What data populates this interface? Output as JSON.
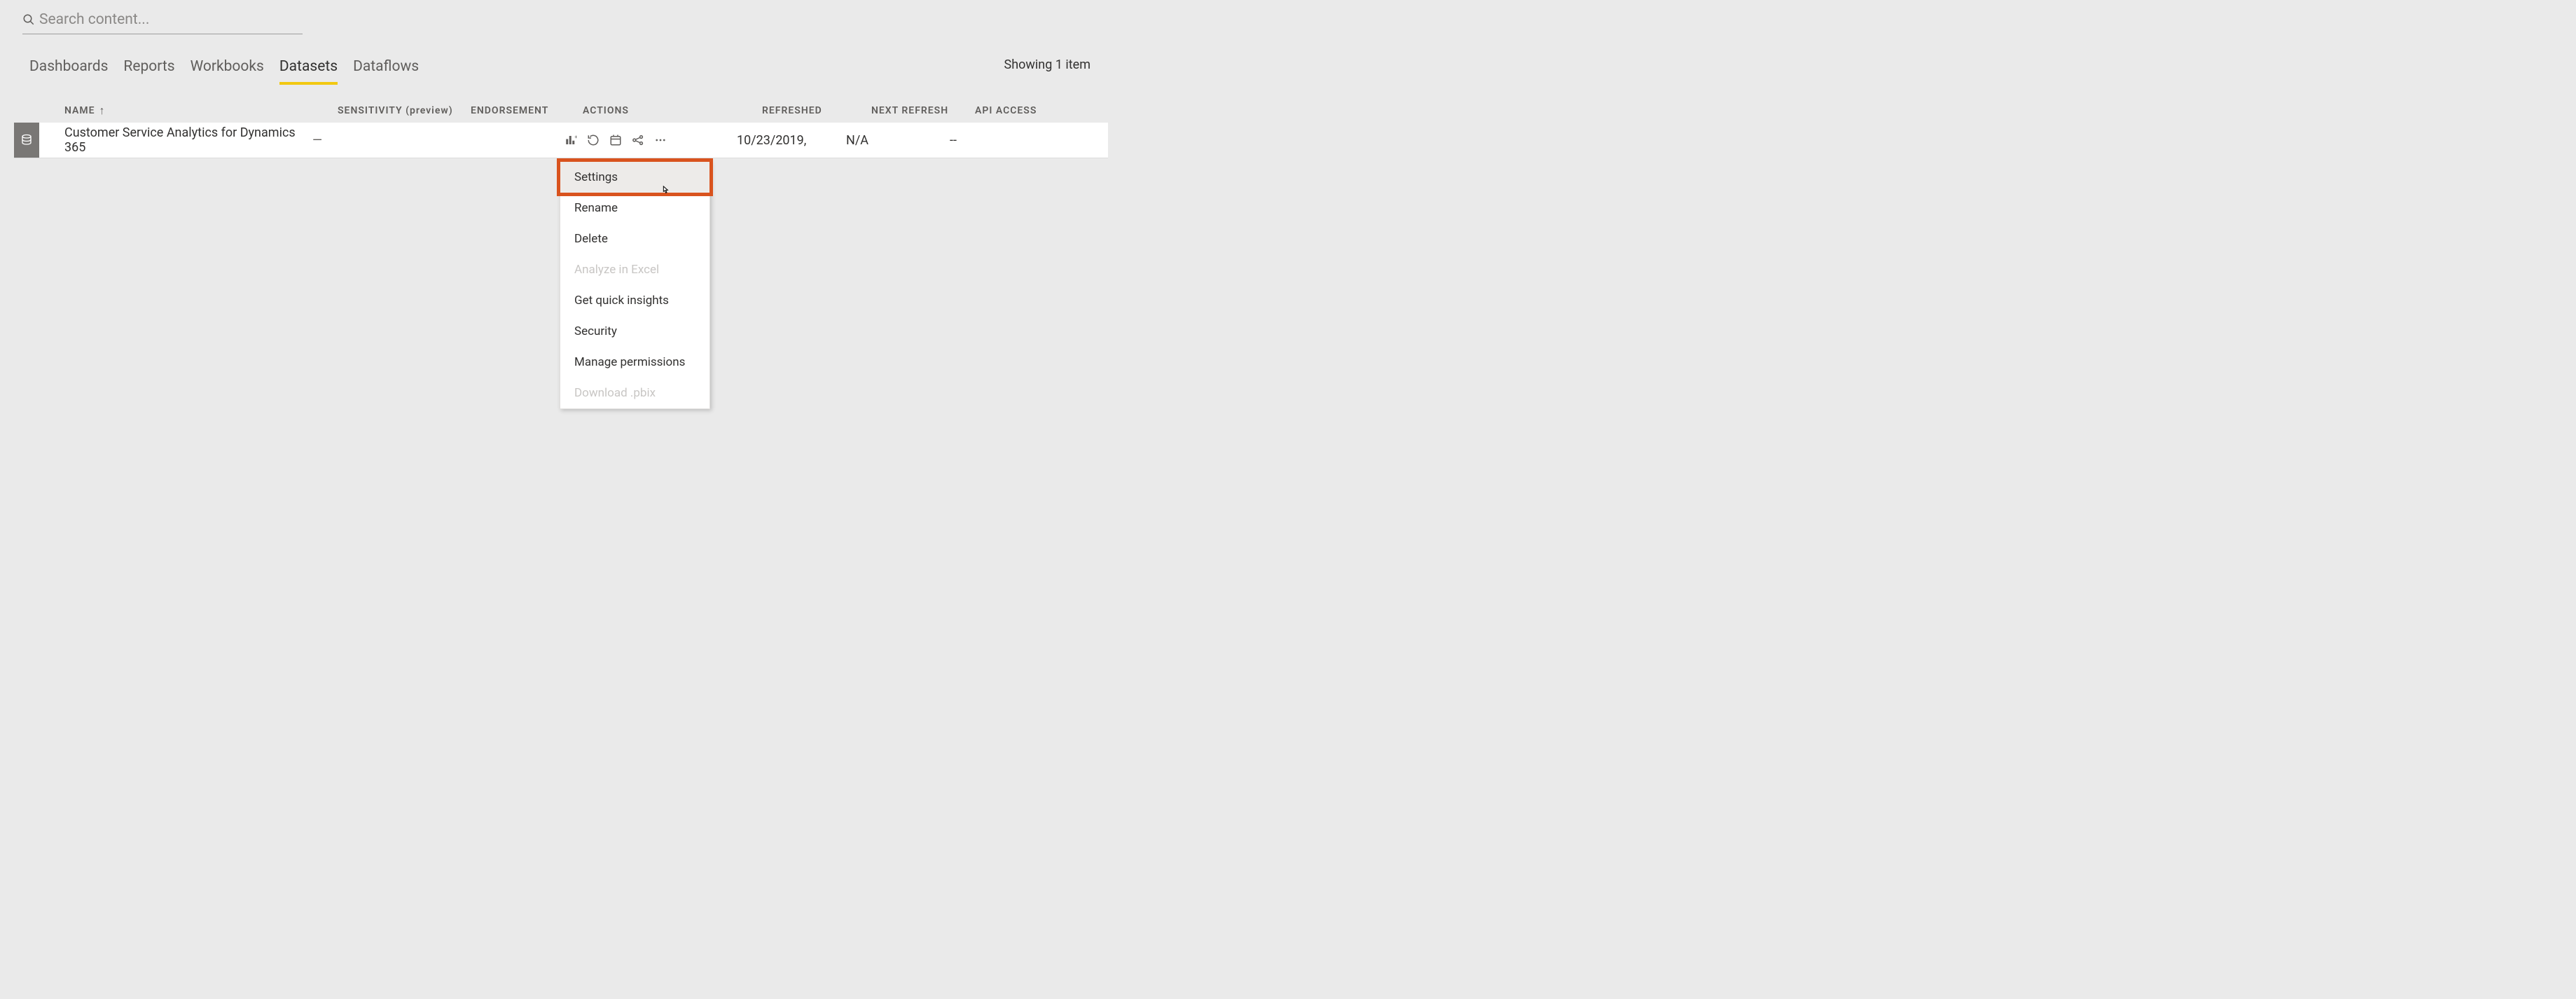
{
  "search": {
    "placeholder": "Search content..."
  },
  "item_count": "Showing 1 item",
  "tabs": [
    {
      "label": "Dashboards",
      "active": false
    },
    {
      "label": "Reports",
      "active": false
    },
    {
      "label": "Workbooks",
      "active": false
    },
    {
      "label": "Datasets",
      "active": true
    },
    {
      "label": "Dataflows",
      "active": false
    }
  ],
  "columns": {
    "name": "NAME",
    "sensitivity": "SENSITIVITY (preview)",
    "endorsement": "ENDORSEMENT",
    "actions": "ACTIONS",
    "refreshed": "REFRESHED",
    "next_refresh": "NEXT REFRESH",
    "api_access": "API ACCESS"
  },
  "rows": [
    {
      "name": "Customer Service Analytics for Dynamics 365",
      "sensitivity": "—",
      "endorsement": "",
      "refreshed": "10/23/2019,",
      "next_refresh": "N/A",
      "api_access": "--"
    }
  ],
  "context_menu": [
    {
      "label": "Settings",
      "disabled": false,
      "highlight": true
    },
    {
      "label": "Rename",
      "disabled": false,
      "highlight": false
    },
    {
      "label": "Delete",
      "disabled": false,
      "highlight": false
    },
    {
      "label": "Analyze in Excel",
      "disabled": true,
      "highlight": false
    },
    {
      "label": "Get quick insights",
      "disabled": false,
      "highlight": false
    },
    {
      "label": "Security",
      "disabled": false,
      "highlight": false
    },
    {
      "label": "Manage permissions",
      "disabled": false,
      "highlight": false
    },
    {
      "label": "Download .pbix",
      "disabled": true,
      "highlight": false
    }
  ]
}
